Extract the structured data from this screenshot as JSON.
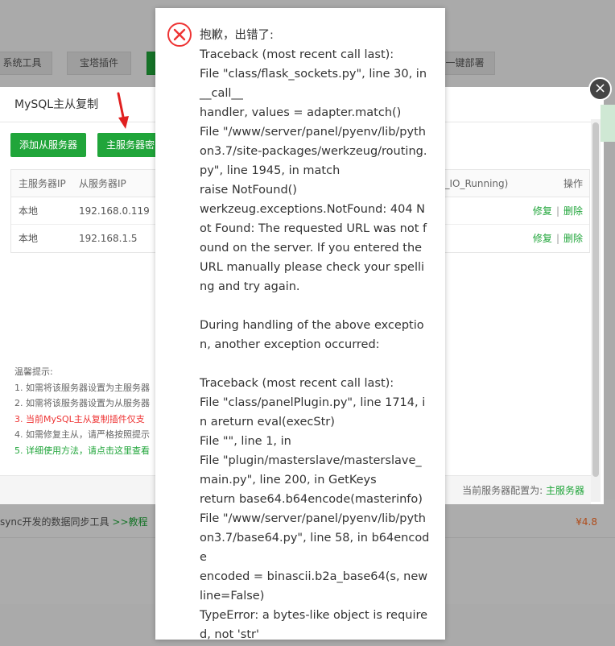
{
  "background": {
    "tabs": [
      {
        "label": "系统工具"
      },
      {
        "label": "宝塔插件"
      },
      {
        "label": ""
      },
      {
        "label": "一键部署"
      }
    ],
    "row": {
      "desc": "sync开发的数据同步工具",
      "tutorial": ">>教程",
      "price": "¥4.8"
    }
  },
  "dialog": {
    "title": "MySQL主从复制",
    "close_label": "×",
    "buttons": {
      "add_slave": "添加从服务器",
      "master_key": "主服务器密"
    },
    "table": {
      "headers": {
        "master_ip": "主服务器IP",
        "slave_ip": "从服务器IP",
        "io_running": "ve_IO_Running)",
        "action": "操作"
      },
      "rows": [
        {
          "master": "本地",
          "slave": "192.168.0.119",
          "repair": "修复",
          "delete": "删除"
        },
        {
          "master": "本地",
          "slave": "192.168.1.5",
          "repair": "修复",
          "delete": "删除"
        }
      ]
    },
    "tips": {
      "title": "温馨提示:",
      "items": [
        "1. 如需将该服务器设置为主服务器",
        "2. 如需将该服务器设置为从服务器",
        "3. 当前MySQL主从复制插件仅支",
        "4. 如需修复主从，请严格按照提示",
        "5. 详细使用方法，请点击这里查看"
      ]
    },
    "footer": {
      "label": "当前服务器配置为:",
      "value": "主服务器"
    }
  },
  "error": {
    "icon": "error-x-icon",
    "message": "抱歉，出错了:\nTraceback (most recent call last):\nFile \"class/flask_sockets.py\", line 30, in __call__\nhandler, values = adapter.match()\nFile \"/www/server/panel/pyenv/lib/python3.7/site-packages/werkzeug/routing.py\", line 1945, in match\nraise NotFound()\nwerkzeug.exceptions.NotFound: 404 Not Found: The requested URL was not found on the server. If you entered the URL manually please check your spelling and try again.\n\nDuring handling of the above exception, another exception occurred:\n\nTraceback (most recent call last):\nFile \"class/panelPlugin.py\", line 1714, in areturn eval(execStr)\nFile \"\", line 1, in\nFile \"plugin/masterslave/masterslave_main.py\", line 200, in GetKeys\nreturn base64.b64encode(masterinfo)\nFile \"/www/server/panel/pyenv/lib/python3.7/base64.py\", line 58, in b64encode\nencoded = binascii.b2a_base64(s, newline=False)\nTypeError: a bytes-like object is required, not 'str'"
  },
  "colors": {
    "accent": "#20a53a",
    "error": "#e33",
    "price": "#fc6d26"
  }
}
